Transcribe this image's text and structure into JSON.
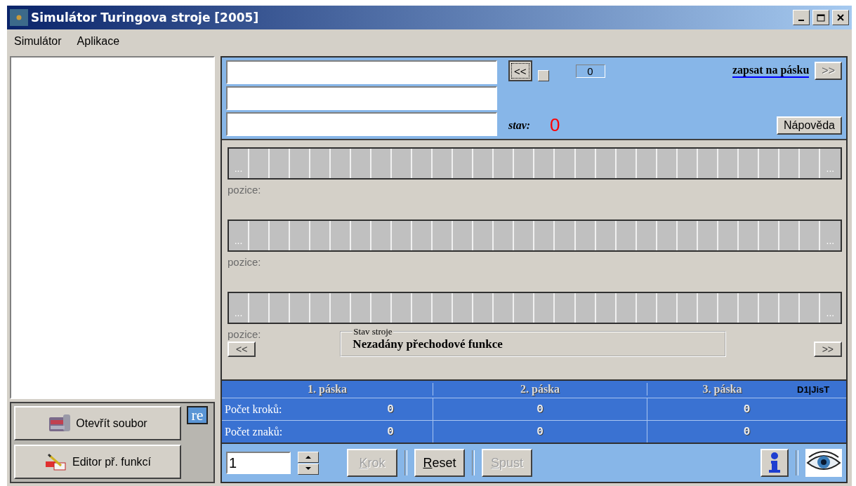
{
  "window": {
    "title": "Simulátor Turingova stroje [2005]"
  },
  "menu": [
    "Simulátor",
    "Aplikace"
  ],
  "sidebar": {
    "buttons": [
      {
        "label": "Otevřít soubor",
        "kind": "open"
      },
      {
        "label": "Editor př. funkcí",
        "kind": "editor"
      }
    ],
    "badge": "re"
  },
  "controls": {
    "back_button": "<<",
    "counter": "0",
    "write_link": "zapsat na pásku",
    "forward_button": ">>",
    "state_label": "stav:",
    "state_value": "0",
    "help_button": "Nápověda"
  },
  "tapes": [
    {
      "start": "...",
      "end": "...",
      "position_label": "pozice:"
    },
    {
      "start": "...",
      "end": "...",
      "position_label": "pozice:"
    },
    {
      "start": "...",
      "end": "...",
      "position_label": "pozice:"
    }
  ],
  "navigation": {
    "prev": "<<",
    "next": ">>"
  },
  "machine_state": {
    "legend": "Stav stroje",
    "message": "Nezadány přechodové funkce"
  },
  "stats": {
    "columns": [
      "1. páska",
      "2. páska",
      "3. páska"
    ],
    "tag": "D1|JisT",
    "rows": [
      {
        "label": "Počet kroků:",
        "values": [
          "0",
          "0",
          "0"
        ]
      },
      {
        "label": "Počet znaků:",
        "values": [
          "0",
          "0",
          "0"
        ]
      }
    ]
  },
  "toolbar": {
    "steps": "1",
    "buttons": [
      {
        "label": "Krok",
        "disabled": true
      },
      {
        "label": "Reset",
        "disabled": false
      },
      {
        "label": "Spust",
        "disabled": true
      }
    ]
  }
}
